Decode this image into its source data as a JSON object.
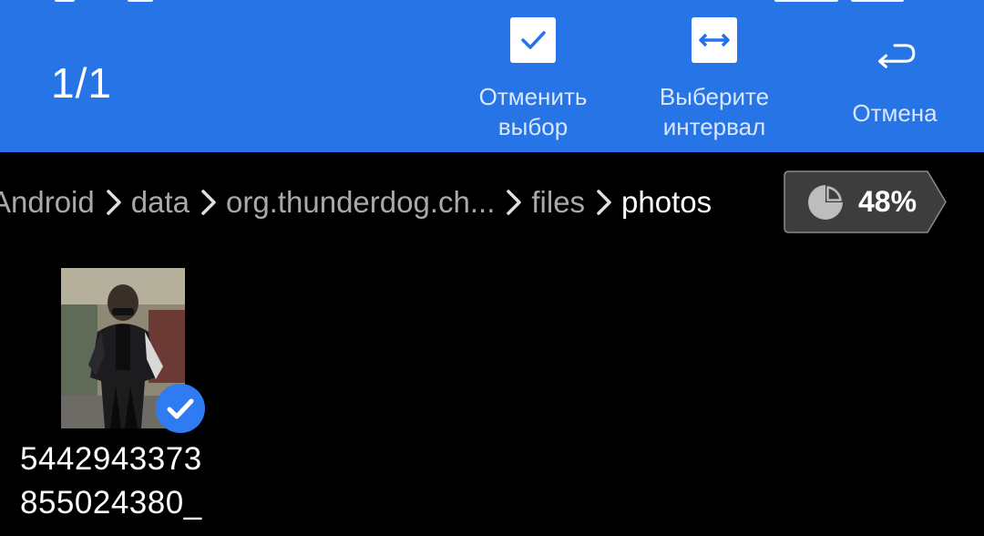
{
  "selection": {
    "count_text": "1/1"
  },
  "actions": {
    "deselect": {
      "label": "Отменить\nвыбор",
      "icon": "checkbox-checked-icon"
    },
    "select_range": {
      "label": "Выберите\nинтервал",
      "icon": "horizontal-range-icon"
    },
    "cancel": {
      "label": "Отмена",
      "icon": "return-arrow-icon"
    }
  },
  "breadcrumb": [
    {
      "label": "Android"
    },
    {
      "label": "data"
    },
    {
      "label": "org.thunderdog.ch..."
    },
    {
      "label": "files"
    },
    {
      "label": "photos"
    }
  ],
  "storage": {
    "usage_text": "48%",
    "usage_fraction": 0.48,
    "icon": "pie-chart-icon"
  },
  "files": [
    {
      "name": "5442943373\n855024380_",
      "selected": true,
      "thumbnail_icon": "photo-thumbnail",
      "badge_icon": "check-circle-icon"
    }
  ],
  "colors": {
    "accent": "#2774e6",
    "background": "#000000",
    "check_badge": "#2f7cf2",
    "breadcrumb_inactive": "#a9a9a9",
    "breadcrumb_active": "#ffffff",
    "badge_bg": "#3d3d3d"
  }
}
